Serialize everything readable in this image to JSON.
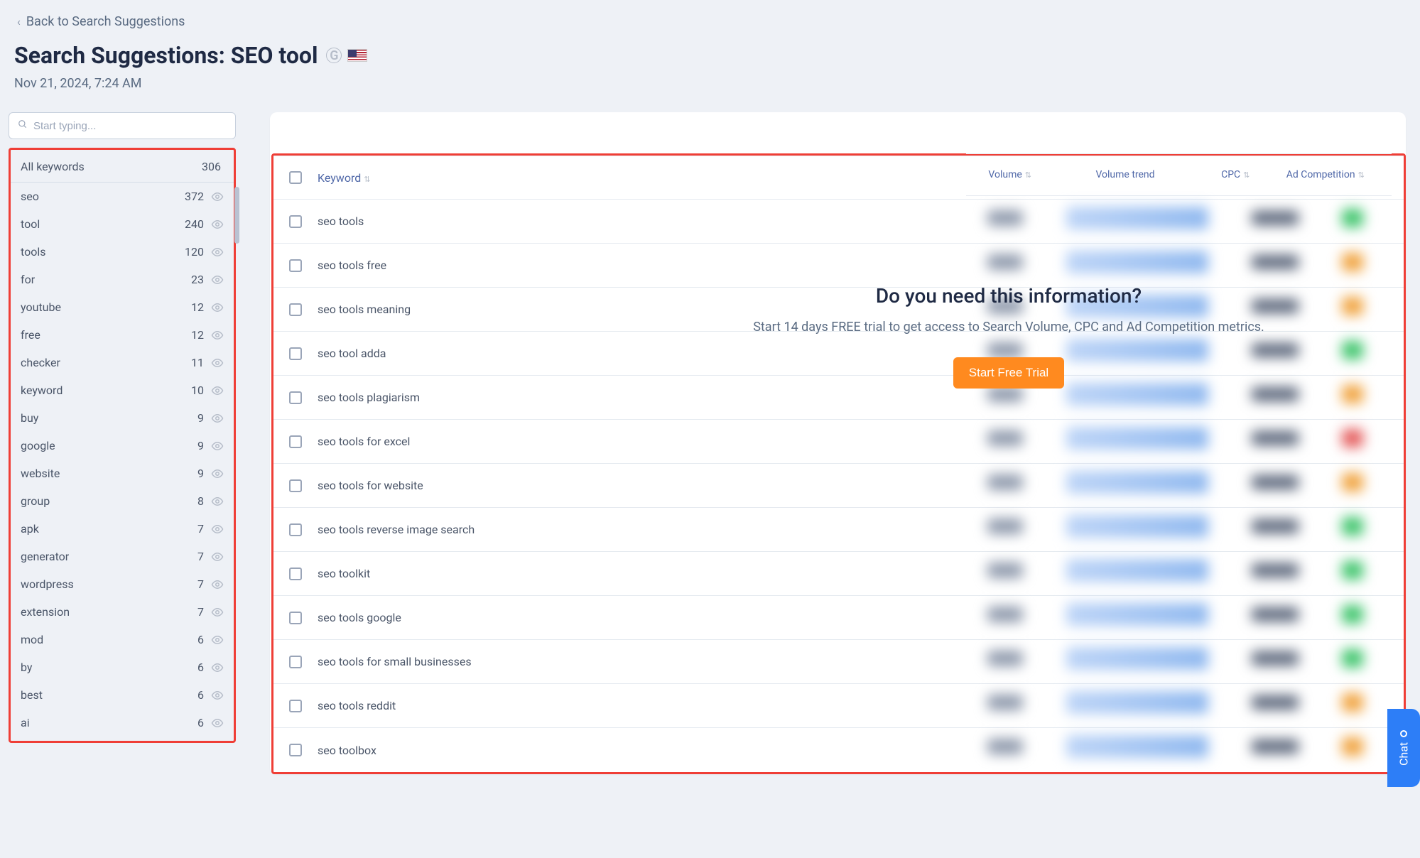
{
  "back_link": "Back to Search Suggestions",
  "title_prefix": "Search Suggestions: ",
  "title_term": "SEO tool",
  "timestamp": "Nov 21, 2024, 7:24 AM",
  "search_placeholder": "Start typing...",
  "sidebar": {
    "all_label": "All keywords",
    "all_count": "306",
    "items": [
      {
        "word": "seo",
        "count": "372"
      },
      {
        "word": "tool",
        "count": "240"
      },
      {
        "word": "tools",
        "count": "120"
      },
      {
        "word": "for",
        "count": "23"
      },
      {
        "word": "youtube",
        "count": "12"
      },
      {
        "word": "free",
        "count": "12"
      },
      {
        "word": "checker",
        "count": "11"
      },
      {
        "word": "keyword",
        "count": "10"
      },
      {
        "word": "buy",
        "count": "9"
      },
      {
        "word": "google",
        "count": "9"
      },
      {
        "word": "website",
        "count": "9"
      },
      {
        "word": "group",
        "count": "8"
      },
      {
        "word": "apk",
        "count": "7"
      },
      {
        "word": "generator",
        "count": "7"
      },
      {
        "word": "wordpress",
        "count": "7"
      },
      {
        "word": "extension",
        "count": "7"
      },
      {
        "word": "mod",
        "count": "6"
      },
      {
        "word": "by",
        "count": "6"
      },
      {
        "word": "best",
        "count": "6"
      },
      {
        "word": "ai",
        "count": "6"
      }
    ]
  },
  "table": {
    "columns": {
      "keyword": "Keyword",
      "volume": "Volume",
      "trend": "Volume trend",
      "cpc": "CPC",
      "comp": "Ad Competition"
    },
    "rows": [
      {
        "keyword": "seo tools",
        "comp": "G"
      },
      {
        "keyword": "seo tools free",
        "comp": "O"
      },
      {
        "keyword": "seo tools meaning",
        "comp": "O"
      },
      {
        "keyword": "seo tool adda",
        "comp": "G"
      },
      {
        "keyword": "seo tools plagiarism",
        "comp": "O"
      },
      {
        "keyword": "seo tools for excel",
        "comp": "R"
      },
      {
        "keyword": "seo tools for website",
        "comp": "O"
      },
      {
        "keyword": "seo tools reverse image search",
        "comp": "G"
      },
      {
        "keyword": "seo toolkit",
        "comp": "G"
      },
      {
        "keyword": "seo tools google",
        "comp": "G"
      },
      {
        "keyword": "seo tools for small businesses",
        "comp": "G"
      },
      {
        "keyword": "seo tools reddit",
        "comp": "O"
      },
      {
        "keyword": "seo toolbox",
        "comp": "O"
      }
    ]
  },
  "overlay": {
    "heading": "Do you need this information?",
    "text": "Start 14 days FREE trial to get access to Search Volume, CPC and Ad Competition metrics.",
    "cta": "Start Free Trial"
  },
  "chat_label": "Chat"
}
